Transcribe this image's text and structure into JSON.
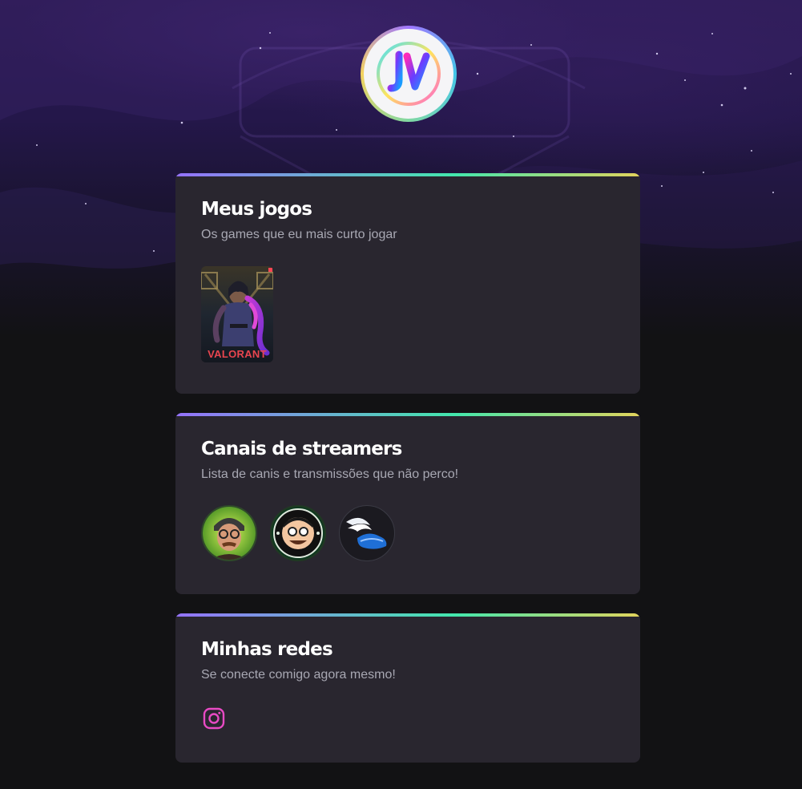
{
  "profile": {
    "logo_text": "JV"
  },
  "cards": {
    "games": {
      "title": "Meus jogos",
      "subtitle": "Os games que eu mais curto jogar",
      "items": [
        {
          "label": "VALORANT"
        }
      ]
    },
    "streamers": {
      "title": "Canais de streamers",
      "subtitle": "Lista de canis e transmissões que não perco!",
      "items": [
        {
          "icon": "streamer-avatar-1"
        },
        {
          "icon": "streamer-avatar-casimiro"
        },
        {
          "icon": "streamer-avatar-wings"
        }
      ]
    },
    "social": {
      "title": "Minhas redes",
      "subtitle": "Se conecte comigo agora mesmo!",
      "items": [
        {
          "icon": "instagram-icon"
        }
      ]
    }
  },
  "colors": {
    "background": "#121214",
    "card": "#29262f",
    "title": "#ffffff",
    "subtitle": "#a8a8b3",
    "accent_gradient": [
      "#9572fc",
      "#43e7ad",
      "#e2d45c"
    ],
    "instagram": "#e84ac4"
  }
}
